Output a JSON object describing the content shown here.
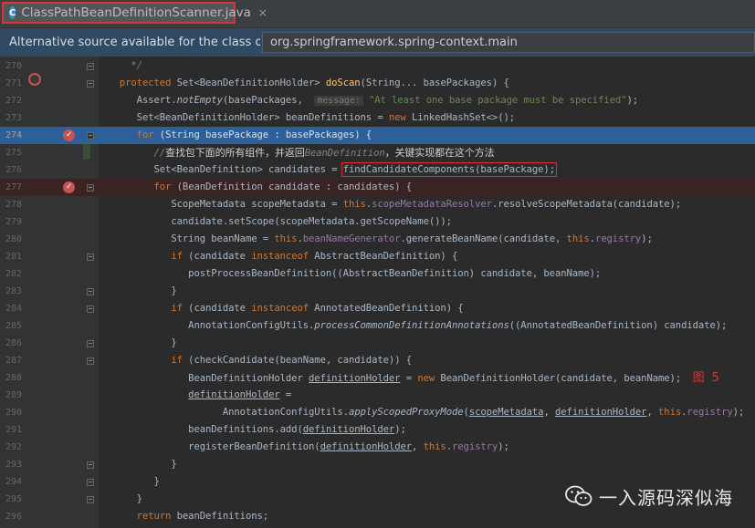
{
  "tab": {
    "title": "ClassPathBeanDefinitionScanner.java",
    "icon": "C",
    "close": "×"
  },
  "notice": {
    "text": "Alternative source available for the class org....",
    "selected": "org.springframework.spring-context.main"
  },
  "annotation": "图 5",
  "watermark": "一入源码深似海",
  "lines": [
    {
      "n": "270",
      "html": "     <span class=\"cm\">*/</span>"
    },
    {
      "n": "271",
      "html": "   <span class=\"kw\">protected</span> Set&lt;BeanDefinitionHolder&gt; <span class=\"fn\">doScan</span>(String... basePackages) {"
    },
    {
      "n": "272",
      "html": "      Assert.<span class=\"it\">notEmpty</span>(basePackages,  <span class=\"hint\">message:</span> <span class=\"str\">\"At least one base package must be specified\"</span>);"
    },
    {
      "n": "273",
      "html": "      Set&lt;BeanDefinitionHolder&gt; beanDefinitions = <span class=\"kw\">new</span> LinkedHashSet&lt;&gt;();"
    },
    {
      "n": "274",
      "html": "      <span class=\"kw\">for</span> (String basePackage : basePackages) {",
      "cls": "cur"
    },
    {
      "n": "275",
      "html": "         <span class=\"cm\">//</span><span class=\"cmcn\">查找包下面的所有组件，并返回</span><span class=\"cm\">BeanDefinition</span><span class=\"cmcn\">，关键实现都在这个方法</span>"
    },
    {
      "n": "276",
      "html": "         Set&lt;BeanDefinition&gt; candidates = <span class=\"redbox\">findCandidateComponents(basePackage);</span>"
    },
    {
      "n": "277",
      "html": "         <span class=\"kw\">for</span> (BeanDefinition candidate : candidates) {",
      "cls": "bp"
    },
    {
      "n": "278",
      "html": "            ScopeMetadata scopeMetadata = <span class=\"kw\">this</span>.<span class=\"fld\">scopeMetadataResolver</span>.resolveScopeMetadata(candidate);"
    },
    {
      "n": "279",
      "html": "            candidate.setScope(scopeMetadata.getScopeName());"
    },
    {
      "n": "280",
      "html": "            String beanName = <span class=\"kw\">this</span>.<span class=\"fld\">beanNameGenerator</span>.generateBeanName(candidate, <span class=\"kw\">this</span>.<span class=\"fld\">registry</span>);"
    },
    {
      "n": "281",
      "html": "            <span class=\"kw\">if</span> (candidate <span class=\"kw\">instanceof</span> AbstractBeanDefinition) {"
    },
    {
      "n": "282",
      "html": "               postProcessBeanDefinition((AbstractBeanDefinition) candidate, beanName);"
    },
    {
      "n": "283",
      "html": "            }"
    },
    {
      "n": "284",
      "html": "            <span class=\"kw\">if</span> (candidate <span class=\"kw\">instanceof</span> AnnotatedBeanDefinition) {"
    },
    {
      "n": "285",
      "html": "               AnnotationConfigUtils.<span class=\"it\">processCommonDefinitionAnnotations</span>((AnnotatedBeanDefinition) candidate);"
    },
    {
      "n": "286",
      "html": "            }"
    },
    {
      "n": "287",
      "html": "            <span class=\"kw\">if</span> (checkCandidate(beanName, candidate)) {"
    },
    {
      "n": "288",
      "html": "               BeanDefinitionHolder <span class=\"ul\">definitionHolder</span> = <span class=\"kw\">new</span> BeanDefinitionHolder(candidate, beanName);  <span class=\"annot\">图  5</span>"
    },
    {
      "n": "289",
      "html": "               <span class=\"ul\">definitionHolder</span> ="
    },
    {
      "n": "290",
      "html": "                     AnnotationConfigUtils.<span class=\"it\">applyScopedProxyMode</span>(<span class=\"ul\">scopeMetadata</span>, <span class=\"ul\">definitionHolder</span>, <span class=\"kw\">this</span>.<span class=\"fld\">registry</span>);"
    },
    {
      "n": "291",
      "html": "               beanDefinitions.add(<span class=\"ul\">definitionHolder</span>);"
    },
    {
      "n": "292",
      "html": "               registerBeanDefinition(<span class=\"ul\">definitionHolder</span>, <span class=\"kw\">this</span>.<span class=\"fld\">registry</span>);"
    },
    {
      "n": "293",
      "html": "            }"
    },
    {
      "n": "294",
      "html": "         }"
    },
    {
      "n": "295",
      "html": "      }"
    },
    {
      "n": "296",
      "html": "      <span class=\"kw\">return</span> beanDefinitions;"
    }
  ]
}
